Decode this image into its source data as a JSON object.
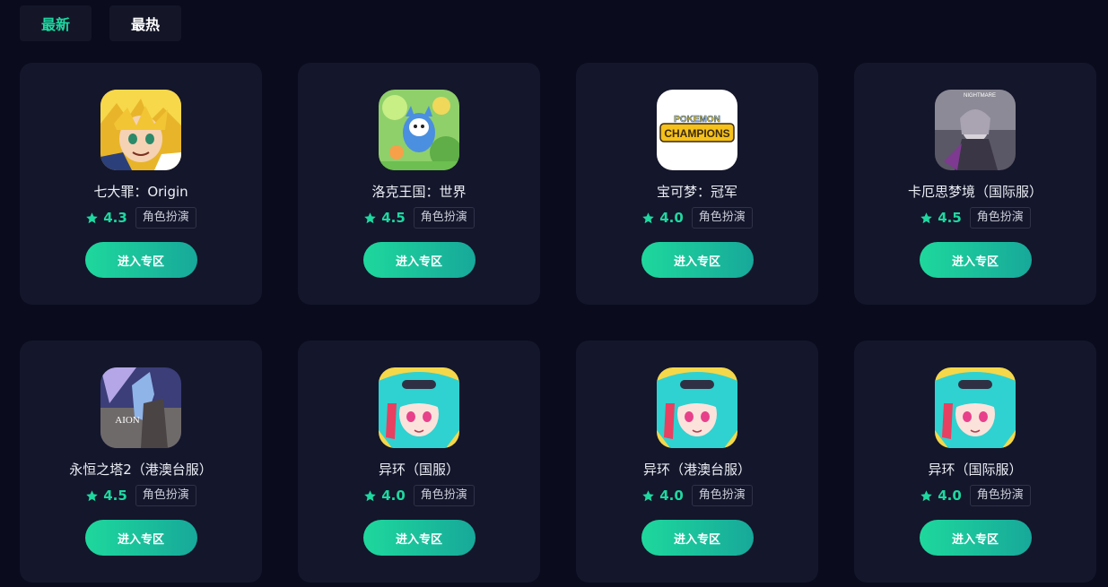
{
  "tabs": [
    {
      "label": "最新",
      "active": true
    },
    {
      "label": "最热",
      "active": false
    }
  ],
  "accent_color": "#1ed8a0",
  "games": [
    {
      "name": "七大罪：Origin",
      "rating": "4.3",
      "tag": "角色扮演",
      "button": "进入专区",
      "icon": "seven-deadly-sins-icon"
    },
    {
      "name": "洛克王国：世界",
      "rating": "4.5",
      "tag": "角色扮演",
      "button": "进入专区",
      "icon": "roco-kingdom-icon"
    },
    {
      "name": "宝可梦：冠军",
      "rating": "4.0",
      "tag": "角色扮演",
      "button": "进入专区",
      "icon": "pokemon-champions-icon",
      "icon_text": {
        "top": "POKEMON",
        "main": "CHAMPIONS"
      }
    },
    {
      "name": "卡厄思梦境（国际服）",
      "rating": "4.5",
      "tag": "角色扮演",
      "button": "进入专区",
      "icon": "chaos-zero-nightmare-icon",
      "icon_text": {
        "top": "NIGHTMARE"
      }
    },
    {
      "name": "永恒之塔2（港澳台服）",
      "rating": "4.5",
      "tag": "角色扮演",
      "button": "进入专区",
      "icon": "aion2-icon",
      "icon_text": {
        "main": "AION"
      }
    },
    {
      "name": "异环（国服）",
      "rating": "4.0",
      "tag": "角色扮演",
      "button": "进入专区",
      "icon": "neverness-to-everness-icon"
    },
    {
      "name": "异环（港澳台服）",
      "rating": "4.0",
      "tag": "角色扮演",
      "button": "进入专区",
      "icon": "neverness-to-everness-icon"
    },
    {
      "name": "异环（国际服）",
      "rating": "4.0",
      "tag": "角色扮演",
      "button": "进入专区",
      "icon": "neverness-to-everness-icon"
    }
  ]
}
